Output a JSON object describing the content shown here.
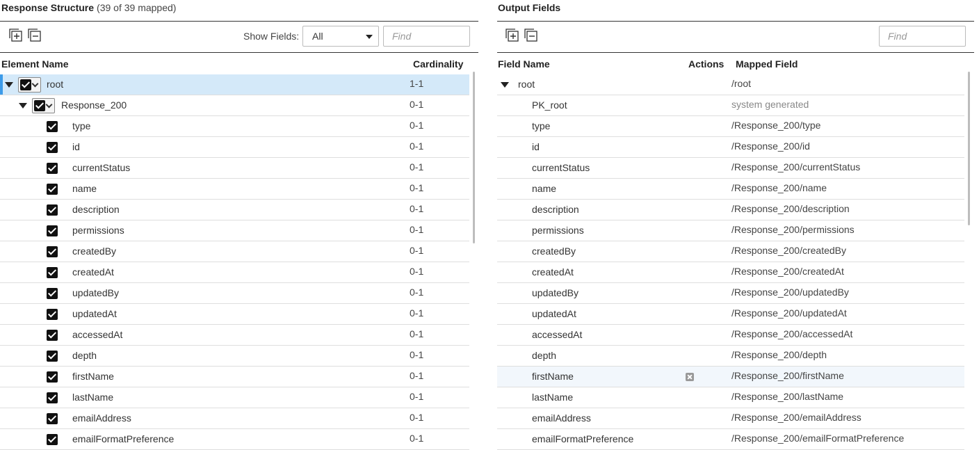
{
  "left": {
    "title": "Response Structure",
    "count": "(39 of 39 mapped)",
    "show_fields_label": "Show Fields:",
    "show_fields_value": "All",
    "find_placeholder": "Find",
    "col_element": "Element Name",
    "col_cardinality": "Cardinality",
    "rows": [
      {
        "name": "root",
        "card": "1-1"
      },
      {
        "name": "Response_200",
        "card": "0-1"
      },
      {
        "name": "type",
        "card": "0-1"
      },
      {
        "name": "id",
        "card": "0-1"
      },
      {
        "name": "currentStatus",
        "card": "0-1"
      },
      {
        "name": "name",
        "card": "0-1"
      },
      {
        "name": "description",
        "card": "0-1"
      },
      {
        "name": "permissions",
        "card": "0-1"
      },
      {
        "name": "createdBy",
        "card": "0-1"
      },
      {
        "name": "createdAt",
        "card": "0-1"
      },
      {
        "name": "updatedBy",
        "card": "0-1"
      },
      {
        "name": "updatedAt",
        "card": "0-1"
      },
      {
        "name": "accessedAt",
        "card": "0-1"
      },
      {
        "name": "depth",
        "card": "0-1"
      },
      {
        "name": "firstName",
        "card": "0-1"
      },
      {
        "name": "lastName",
        "card": "0-1"
      },
      {
        "name": "emailAddress",
        "card": "0-1"
      },
      {
        "name": "emailFormatPreference",
        "card": "0-1"
      }
    ]
  },
  "right": {
    "title": "Output Fields",
    "find_placeholder": "Find",
    "col_field": "Field Name",
    "col_actions": "Actions",
    "col_mapped": "Mapped Field",
    "rows": [
      {
        "name": "root",
        "mapped": "/root"
      },
      {
        "name": "PK_root",
        "mapped": "system generated"
      },
      {
        "name": "type",
        "mapped": "/Response_200/type"
      },
      {
        "name": "id",
        "mapped": "/Response_200/id"
      },
      {
        "name": "currentStatus",
        "mapped": "/Response_200/currentStatus"
      },
      {
        "name": "name",
        "mapped": "/Response_200/name"
      },
      {
        "name": "description",
        "mapped": "/Response_200/description"
      },
      {
        "name": "permissions",
        "mapped": "/Response_200/permissions"
      },
      {
        "name": "createdBy",
        "mapped": "/Response_200/createdBy"
      },
      {
        "name": "createdAt",
        "mapped": "/Response_200/createdAt"
      },
      {
        "name": "updatedBy",
        "mapped": "/Response_200/updatedBy"
      },
      {
        "name": "updatedAt",
        "mapped": "/Response_200/updatedAt"
      },
      {
        "name": "accessedAt",
        "mapped": "/Response_200/accessedAt"
      },
      {
        "name": "depth",
        "mapped": "/Response_200/depth"
      },
      {
        "name": "firstName",
        "mapped": "/Response_200/firstName"
      },
      {
        "name": "lastName",
        "mapped": "/Response_200/lastName"
      },
      {
        "name": "emailAddress",
        "mapped": "/Response_200/emailAddress"
      },
      {
        "name": "emailFormatPreference",
        "mapped": "/Response_200/emailFormatPreference"
      }
    ]
  },
  "icons": {
    "expand_all": "expand-all-icon",
    "collapse_all": "collapse-all-icon",
    "remove_mapping": "remove-mapping-icon"
  },
  "colors": {
    "selected_row": "#d4e9f9",
    "selected_accent": "#3d9be9",
    "hovered_row": "#f2f7fc"
  }
}
